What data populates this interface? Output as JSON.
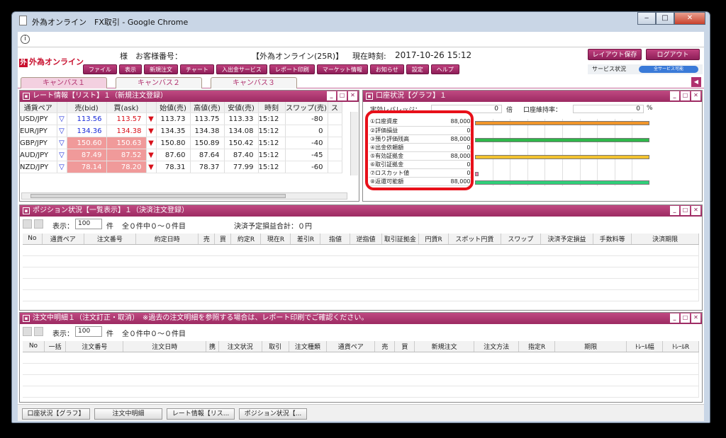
{
  "window": {
    "title": "外為オンライン　FX取引 - Google Chrome",
    "minimize": "‒",
    "maximize": "□",
    "close": "✕"
  },
  "header": {
    "logo": "外為オンライン",
    "account_label": "様　お客様番号：",
    "brand": "【外為オンライン(25R)】",
    "time_label": "現在時刻:",
    "time_value": "2017-10-26 15:12",
    "menu": [
      "ファイル",
      "表示",
      "新規注文",
      "チャート",
      "入出金サービス",
      "レポート印刷",
      "マーケット情報",
      "お知らせ",
      "設定",
      "ヘルプ"
    ],
    "layout_save": "レイアウト保存",
    "logout": "ログアウト",
    "service_label": "サービス状況",
    "service_status": "全サービス可能"
  },
  "canvas_tabs": [
    "キャンバス１",
    "キャンバス２",
    "キャンバス３"
  ],
  "rate_panel": {
    "title": "レート情報【リスト】１（新規注文登録）",
    "columns": [
      "通貨ペア",
      "売(bid)",
      "買(ask)",
      "始値(売)",
      "高値(売)",
      "安値(売)",
      "時刻",
      "スワップ(売)",
      "ス"
    ],
    "rows": [
      {
        "pair": "USD/JPY",
        "bid": "113.56",
        "ask": "113.57",
        "open": "113.73",
        "high": "113.75",
        "low": "113.33",
        "time": "15:12",
        "swap": "-80"
      },
      {
        "pair": "EUR/JPY",
        "bid": "134.36",
        "ask": "134.38",
        "open": "134.35",
        "high": "134.38",
        "low": "134.08",
        "time": "15:12",
        "swap": "0"
      },
      {
        "pair": "GBP/JPY",
        "bid": "150.60",
        "ask": "150.63",
        "open": "150.80",
        "high": "150.89",
        "low": "150.42",
        "time": "15:12",
        "swap": "-40"
      },
      {
        "pair": "AUD/JPY",
        "bid": "87.49",
        "ask": "87.52",
        "open": "87.60",
        "high": "87.64",
        "low": "87.40",
        "time": "15:12",
        "swap": "-45"
      },
      {
        "pair": "NZD/JPY",
        "bid": "78.14",
        "ask": "78.20",
        "open": "78.31",
        "high": "78.37",
        "low": "77.99",
        "time": "15:12",
        "swap": "-60"
      }
    ]
  },
  "account_panel": {
    "title": "口座状況【グラフ】１",
    "leverage_label": "実効レバレッジ：",
    "leverage_value": "0",
    "leverage_unit": "倍",
    "margin_label": "口座維持率：",
    "margin_value": "0",
    "margin_unit": "%",
    "rows": [
      {
        "label": "①口座資産",
        "value": "88,000",
        "fill": 1.0,
        "color": "#f0952a"
      },
      {
        "label": "②評価損益",
        "value": "0",
        "fill": 0,
        "color": "#cccccc"
      },
      {
        "label": "③預り評価残高",
        "value": "88,000",
        "fill": 1.0,
        "color": "#2fb84a"
      },
      {
        "label": "④出金依頼額",
        "value": "0",
        "fill": 0,
        "color": "#cccccc"
      },
      {
        "label": "⑤有効証拠金",
        "value": "88,000",
        "fill": 1.0,
        "color": "#f2c230"
      },
      {
        "label": "⑥取引証拠金",
        "value": "0",
        "fill": 0,
        "color": "#cccccc"
      },
      {
        "label": "⑦ロスカット値",
        "value": "0",
        "fill": 0.02,
        "color": "#e87fa8"
      },
      {
        "label": "⑧返還可能額",
        "value": "88,000",
        "fill": 1.0,
        "color": "#2fd07a"
      }
    ]
  },
  "position_panel": {
    "title": "ポジション状況【一覧表示】１（決済注文登録）",
    "display_label": "表示：",
    "per_page": "100",
    "unit": "件",
    "count_text": "全０件中０～０件目",
    "pnl_total": "決済予定損益合計：０円",
    "columns": [
      "No",
      "通貨ペア",
      "注文番号",
      "約定日時",
      "売",
      "買",
      "約定R",
      "現在R",
      "差引R",
      "指値",
      "逆指値",
      "取引証拠金",
      "円貨R",
      "スポット円貨",
      "スワップ",
      "決済予定損益",
      "手数料等",
      "決済期限"
    ]
  },
  "order_panel": {
    "title": "注文中明細１（注文訂正・取消）　※過去の注文明細を参照する場合は、レポート印刷でご確認ください。",
    "display_label": "表示：",
    "per_page": "100",
    "unit": "件",
    "count_text": "全０件中０～０件目",
    "columns": [
      "No",
      "一括",
      "注文番号",
      "注文日時",
      "携",
      "注文状況",
      "取引",
      "注文種類",
      "通貨ペア",
      "売",
      "買",
      "新規注文",
      "注文方法",
      "指定R",
      "期限",
      "ﾄﾚｰﾙ幅",
      "ﾄﾚｰﾙR"
    ]
  },
  "taskbar": [
    "口座状況【グラフ】",
    "注文中明細",
    "レート情報【リス...",
    "ポジション状況【..."
  ]
}
